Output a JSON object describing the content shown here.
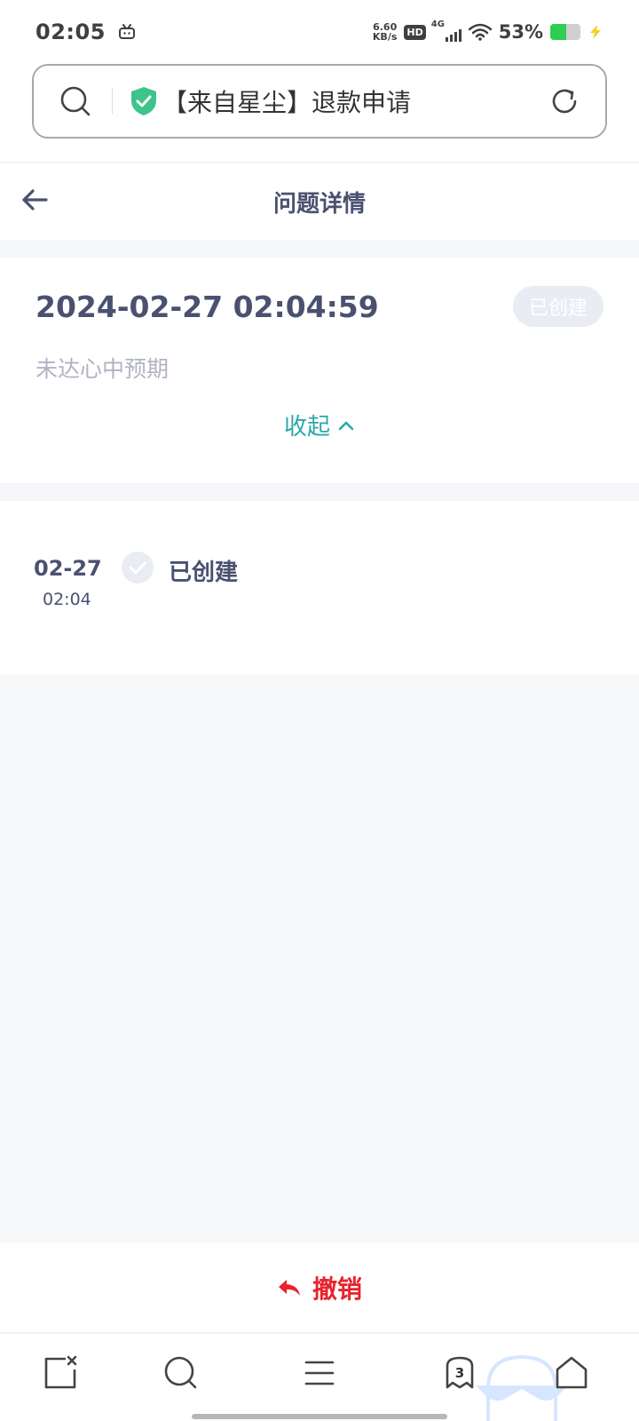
{
  "status_bar": {
    "time": "02:05",
    "net_speed_value": "6.60",
    "net_speed_unit": "KB/s",
    "hd_label": "HD",
    "network_label": "4G",
    "battery_percent_text": "53%",
    "battery_level": 0.53,
    "icons": [
      "tv-icon",
      "signal-icon",
      "wifi-icon",
      "battery-icon",
      "charging-icon"
    ]
  },
  "address_bar": {
    "title": "【来自星尘】退款申请",
    "icons": [
      "search-icon",
      "shield-check-icon",
      "refresh-icon"
    ]
  },
  "header": {
    "title": "问题详情",
    "back_icon": "back-arrow-icon"
  },
  "issue": {
    "datetime": "2024-02-27 02:04:59",
    "status_badge": "已创建",
    "reason": "未达心中预期",
    "collapse_label": "收起"
  },
  "timeline": [
    {
      "date": "02-27",
      "time": "02:04",
      "status": "已创建"
    }
  ],
  "actions": {
    "revoke_label": "撤销",
    "revoke_color": "#e7232f"
  },
  "bottom_nav": {
    "tabs_count": "3",
    "icons": [
      "close-tab-icon",
      "search-icon",
      "menu-icon",
      "tabs-icon",
      "home-icon"
    ]
  },
  "colors": {
    "primary_text": "#4a5170",
    "accent_teal": "#2aa8a9",
    "danger": "#e7232f",
    "shield_green": "#3ec38b"
  }
}
